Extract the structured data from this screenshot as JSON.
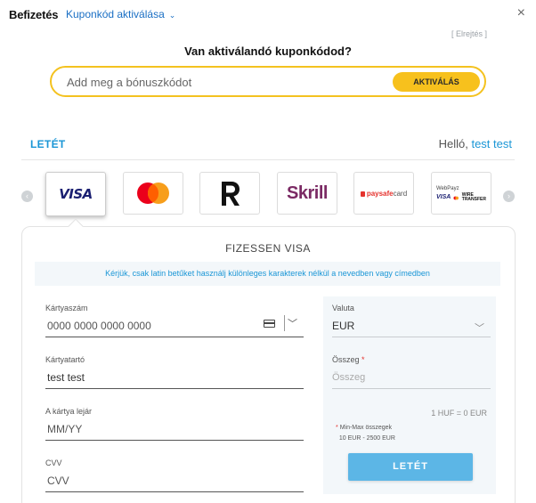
{
  "header": {
    "title": "Befizetés",
    "coupon_toggle": "Kuponkód aktiválása",
    "close_symbol": "×"
  },
  "coupon": {
    "hide_link": "[ Elrejtés ]",
    "title": "Van aktiválandó kuponkódod?",
    "placeholder": "Add meg a bónuszkódot",
    "button": "AKTIVÁLÁS",
    "border_color": "#f4c21f",
    "button_color": "#f7c11d"
  },
  "deposit": {
    "tab_label": "LETÉT",
    "greeting": "Helló,",
    "username": "test test"
  },
  "methods": [
    {
      "name": "VISA",
      "icon": "visa-icon",
      "selected": true
    },
    {
      "name": "Mastercard",
      "icon": "mastercard-icon",
      "selected": false
    },
    {
      "name": "Revolut",
      "icon": "revolut-icon",
      "selected": false
    },
    {
      "name": "Skrill",
      "icon": "skrill-icon",
      "selected": false
    },
    {
      "name": "paysafecard",
      "icon": "paysafecard-icon",
      "selected": false
    },
    {
      "name": "WebPayz",
      "icon": "webpayz-icon",
      "selected": false
    }
  ],
  "logos": {
    "visa": "VISA",
    "skrill": "Skrill",
    "psc_a": "paysafe",
    "psc_b": "card",
    "wp_title": "WebPayz",
    "wp_visa": "VISA",
    "wp_wire_a": "WIRE",
    "wp_wire_b": "TRANSFER"
  },
  "form": {
    "title": "FIZESSEN VISA",
    "notice": "Kérjük, csak latin betűket használj különleges karakterek nélkül a nevedben vagy címedben",
    "card_number_label": "Kártyaszám",
    "card_number_placeholder": "0000 0000 0000 0000",
    "holder_label": "Kártyatartó",
    "holder_value": "test test",
    "expiry_label": "A kártya lejár",
    "expiry_placeholder": "MM/YY",
    "cvv_label": "CVV",
    "cvv_placeholder": "CVV"
  },
  "side": {
    "currency_label": "Valuta",
    "currency_value": "EUR",
    "amount_label": "Összeg",
    "amount_required": "*",
    "amount_placeholder": "Összeg",
    "rate": "1 HUF = 0 EUR",
    "minmax_star": "*",
    "minmax_line1": "Min-Max összegek",
    "minmax_line2": "10 EUR - 2500 EUR",
    "submit": "LETÉT",
    "accent": "#5cb6e6"
  },
  "colors": {
    "link": "#1a96d6",
    "brand_blue": "#1a6fc4"
  }
}
